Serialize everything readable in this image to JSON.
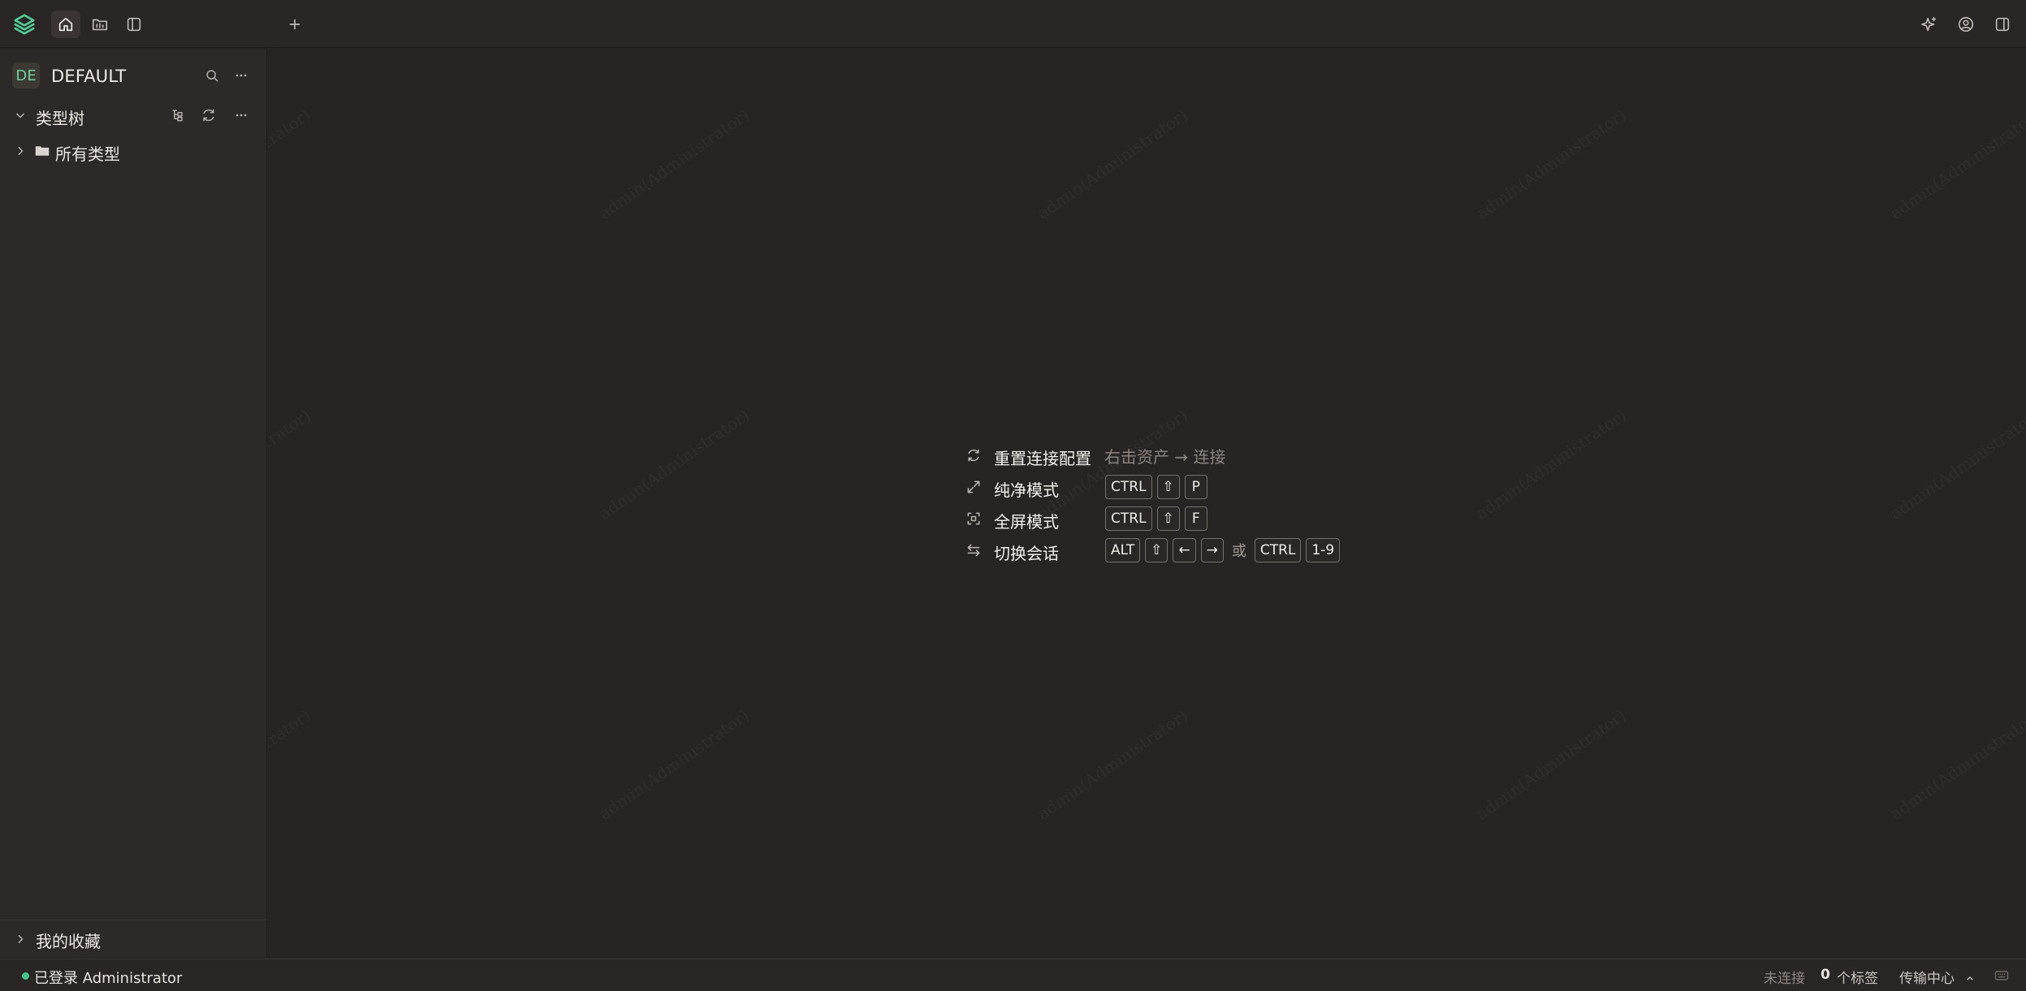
{
  "topbar": {
    "tabs": [
      {
        "icon": "home-icon",
        "active": true
      },
      {
        "icon": "folder-icon",
        "active": false
      },
      {
        "icon": "sidebar-layout-icon",
        "active": false
      }
    ],
    "new_tab_icon": "plus-icon",
    "right_icons": [
      "sparkle-icon",
      "user-circle-icon",
      "panel-right-icon"
    ]
  },
  "sidebar": {
    "workspace": {
      "avatar": "DE",
      "name": "DEFAULT"
    },
    "tree": {
      "title": "类型树",
      "items": [
        {
          "label": "所有类型"
        }
      ]
    },
    "favorites_label": "我的收藏"
  },
  "main": {
    "watermark_text": "admin(Administrator)",
    "shortcuts": [
      {
        "icon": "refresh-icon",
        "label": "重置连接配置",
        "hint": "右击资产 → 连接",
        "keys": []
      },
      {
        "icon": "expand-icon",
        "label": "纯净模式",
        "keys": [
          "CTRL",
          "⇧",
          "P"
        ]
      },
      {
        "icon": "fullscreen-icon",
        "label": "全屏模式",
        "keys": [
          "CTRL",
          "⇧",
          "F"
        ]
      },
      {
        "icon": "switch-icon",
        "label": "切换会话",
        "keys": [
          "ALT",
          "⇧",
          "←",
          "→"
        ],
        "or": "或",
        "alt_keys": [
          "CTRL",
          "1-9"
        ]
      }
    ]
  },
  "status": {
    "login": "已登录 Administrator",
    "connection": "未连接",
    "tag_count": "0",
    "tag_label": "个标签",
    "transfer": "传输中心"
  },
  "colors": {
    "accent": "#3fc88a",
    "background": "#282424",
    "sidebar": "#2d2929"
  }
}
